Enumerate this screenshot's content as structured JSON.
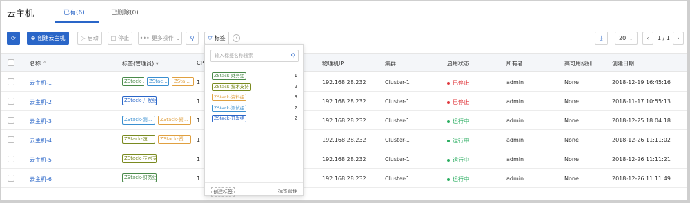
{
  "app": {
    "title": "云主机"
  },
  "tabs": [
    {
      "label": "已有(6)",
      "active": true
    },
    {
      "label": "已删除(0)",
      "active": false
    }
  ],
  "toolbar": {
    "refresh_icon": "refresh-icon",
    "create_label": "创建云主机",
    "start_label": "启动",
    "stop_label": "停止",
    "more_label": "更多操作",
    "search_icon": "search-icon",
    "tag_label": "标签",
    "help_glyph": "?"
  },
  "pager": {
    "page_size": "20",
    "page_text": "1 / 1"
  },
  "colors": {
    "accent": "#2a66c8",
    "running": "#2bae61",
    "stopped": "#e0393e"
  },
  "table": {
    "headers": {
      "name": "名称",
      "tags": "标签(管理员)",
      "cpu": "CP",
      "ip": "物理机IP",
      "cluster": "集群",
      "state": "启用状态",
      "owner": "所有者",
      "ha": "高可用级别",
      "created": "创建日期"
    },
    "rows": [
      {
        "name": "云主机-1",
        "cpu": "1",
        "ip": "192.168.28.232",
        "cluster": "Cluster-1",
        "state": "已停止",
        "owner": "admin",
        "ha": "None",
        "created": "2018-12-19 16:45:16",
        "tags": [
          {
            "text": "ZStack-...",
            "color": "#4a8a4a"
          },
          {
            "text": "ZStac...",
            "color": "#3a8fd0"
          },
          {
            "text": "ZSta...",
            "color": "#e0a040"
          }
        ]
      },
      {
        "name": "云主机-2",
        "cpu": "1",
        "ip": "192.168.28.232",
        "cluster": "Cluster-1",
        "state": "已停止",
        "owner": "admin",
        "ha": "None",
        "created": "2018-11-17 10:55:13",
        "tags": [
          {
            "text": "ZStack-开发组",
            "color": "#2a66c8"
          }
        ]
      },
      {
        "name": "云主机-3",
        "cpu": "1",
        "ip": "192.168.28.232",
        "cluster": "Cluster-1",
        "state": "运行中",
        "owner": "admin",
        "ha": "None",
        "created": "2018-12-25 18:04:18",
        "tags": [
          {
            "text": "ZStack-测...",
            "color": "#3a8fd0"
          },
          {
            "text": "ZStack-资...",
            "color": "#e0a040"
          }
        ]
      },
      {
        "name": "云主机-4",
        "cpu": "1",
        "ip": "192.168.28.232",
        "cluster": "Cluster-1",
        "state": "运行中",
        "owner": "admin",
        "ha": "None",
        "created": "2018-12-26 11:11:02",
        "tags": [
          {
            "text": "ZStack-技...",
            "color": "#7a8a20"
          },
          {
            "text": "ZStack-资...",
            "color": "#e0a040"
          }
        ]
      },
      {
        "name": "云主机-5",
        "cpu": "1",
        "ip": "192.168.28.232",
        "cluster": "Cluster-1",
        "state": "运行中",
        "owner": "admin",
        "ha": "None",
        "created": "2018-12-26 11:11:21",
        "tags": [
          {
            "text": "ZStack-技术支持",
            "color": "#7a8a20"
          }
        ]
      },
      {
        "name": "云主机-6",
        "cpu": "1",
        "ip": "192.168.28.232",
        "cluster": "Cluster-1",
        "state": "运行中",
        "owner": "admin",
        "ha": "None",
        "created": "2018-12-26 11:11:49",
        "tags": [
          {
            "text": "ZStack-财务组",
            "color": "#4a8a4a"
          }
        ]
      }
    ]
  },
  "tag_dropdown": {
    "search_placeholder": "输入标签名称搜索",
    "items": [
      {
        "label": "ZStack-财务组",
        "count": "1",
        "color": "#4a8a4a"
      },
      {
        "label": "ZStack-技术支持",
        "count": "2",
        "color": "#7a8a20"
      },
      {
        "label": "ZStack-资料组",
        "count": "3",
        "color": "#e0a040"
      },
      {
        "label": "ZStack-测试组",
        "count": "2",
        "color": "#3a8fd0"
      },
      {
        "label": "ZStack-开发组",
        "count": "2",
        "color": "#2a66c8"
      }
    ],
    "create_label": "创建标签",
    "manage_label": "标签管理"
  }
}
